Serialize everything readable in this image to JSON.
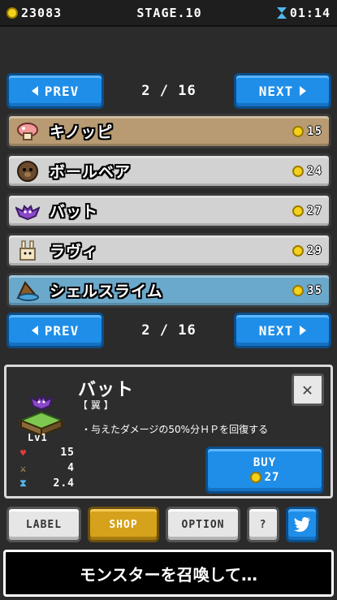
{
  "status": {
    "coins": "23083",
    "stage": "STAGE.10",
    "time": "01:14"
  },
  "pager": {
    "prev_label": "PREV",
    "next_label": "NEXT",
    "page": "2 / 16"
  },
  "monsters": [
    {
      "name": "キノッピ",
      "price": "15",
      "bg": "#b89b72",
      "icon": "mushroom-icon"
    },
    {
      "name": "ボールベア",
      "price": "24",
      "bg": "#d2d2d2",
      "icon": "ball-bear-icon"
    },
    {
      "name": "バット",
      "price": "27",
      "bg": "#d2d2d2",
      "icon": "bat-icon"
    },
    {
      "name": "ラヴィ",
      "price": "29",
      "bg": "#d2d2d2",
      "icon": "rabbit-icon"
    },
    {
      "name": "シェルスライム",
      "price": "35",
      "bg": "#6ba9cc",
      "icon": "shell-slime-icon"
    }
  ],
  "detail": {
    "name": "バット",
    "type": "【 翼 】",
    "description": "・与えたダメージの50%分ＨＰを回復する",
    "level": "Lv1",
    "hp": "15",
    "attack": "4",
    "speed": "2.4",
    "close_label": "✕",
    "buy_label": "BUY",
    "buy_price": "27"
  },
  "menu": {
    "label": "LABEL",
    "shop": "SHOP",
    "option": "OPTION",
    "help": "?"
  },
  "message": "モンスターを召喚して…",
  "colors": {
    "accent_blue": "#1f8ee8",
    "shop_gold": "#d6a21c",
    "coin": "#f4d21a"
  }
}
